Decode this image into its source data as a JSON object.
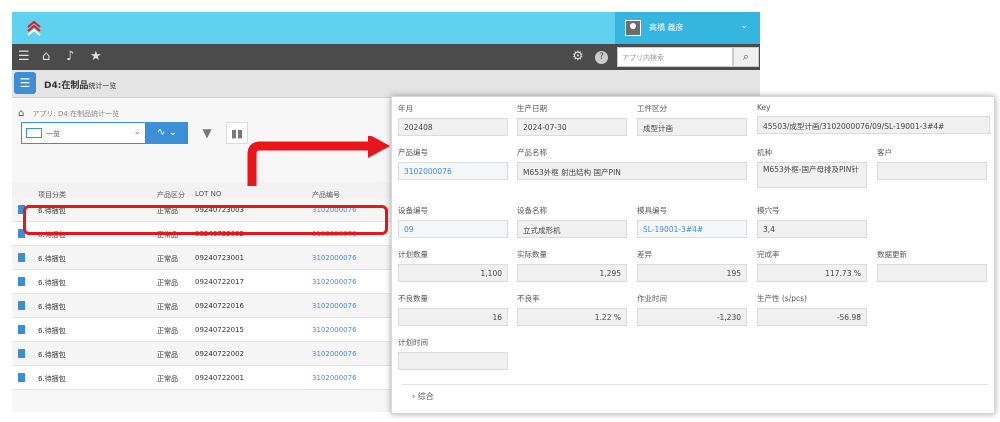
{
  "header": {
    "user_name": "高橋 義彦"
  },
  "toolbar": {
    "search_placeholder": "アプリ内検索"
  },
  "app": {
    "title_main": "D4:在制品",
    "title_sub": "统计一览"
  },
  "breadcrumb": {
    "path": "アプリ: D4:在制品统计一览"
  },
  "view": {
    "selected": "一览"
  },
  "table": {
    "headers": [
      "项目分类",
      "产品区分",
      "LOT NO",
      "产品编号"
    ],
    "rows": [
      [
        "6.待捆包",
        "正常品",
        "09240723003",
        "3102000076"
      ],
      [
        "6.待捆包",
        "正常品",
        "09240723002",
        "3102000076"
      ],
      [
        "6.待捆包",
        "正常品",
        "09240723001",
        "3102000076"
      ],
      [
        "6.待捆包",
        "正常品",
        "09240722017",
        "3102000076"
      ],
      [
        "6.待捆包",
        "正常品",
        "09240722016",
        "3102000076"
      ],
      [
        "6.待捆包",
        "正常品",
        "09240722015",
        "3102000076"
      ],
      [
        "6.待捆包",
        "正常品",
        "09240722002",
        "3102000076"
      ],
      [
        "6.待捆包",
        "正常品",
        "09240722001",
        "3102000076"
      ]
    ]
  },
  "detail": {
    "nianyue": {
      "label": "年月",
      "value": "202408"
    },
    "shengchan_riqi": {
      "label": "生产日期",
      "value": "2024-07-30"
    },
    "gongjian_qufen": {
      "label": "工件区分",
      "value": "成型计画"
    },
    "key": {
      "label": "Key",
      "value": "45503/成型计画/3102000076/09/SL-19001-3#4#"
    },
    "chanpin_bianhao": {
      "label": "产品编号",
      "value": "3102000076"
    },
    "chanpin_mingcheng": {
      "label": "产品名称",
      "value": "M653外框 射出结构 国产PIN"
    },
    "jizhong": {
      "label": "机种",
      "value": "M653外框-国产母排及PIN针"
    },
    "kehu": {
      "label": "客户",
      "value": ""
    },
    "shebei_bianhao": {
      "label": "设备编号",
      "value": "09"
    },
    "shebei_mingcheng": {
      "label": "设备名称",
      "value": "立式成形机"
    },
    "mouju_bianhao": {
      "label": "模具编号",
      "value": "SL-19001-3#4#"
    },
    "moxuehao": {
      "label": "模穴号",
      "value": "3,4"
    },
    "jihua_shuliang": {
      "label": "计划数量",
      "value": "1,100"
    },
    "shiji_shuliang": {
      "label": "实际数量",
      "value": "1,295"
    },
    "chayi": {
      "label": "差异",
      "value": "195"
    },
    "wanchenglv": {
      "label": "完成率",
      "value": "117.73 %"
    },
    "shuju_gengxin": {
      "label": "数据更新",
      "value": ""
    },
    "buliang_shu": {
      "label": "不良数量",
      "value": "16"
    },
    "buliang_lv": {
      "label": "不良率",
      "value": "1.22 %"
    },
    "zuoye_shijian": {
      "label": "作业时间",
      "value": "-1,230"
    },
    "shengchanxing": {
      "label": "生产性 (s/pcs)",
      "value": "-56.98"
    },
    "jihua_shijian": {
      "label": "计划时间",
      "value": ""
    },
    "group_label": "综合"
  },
  "colors": {
    "header": "#5ed2ee",
    "accent": "#3a8fd6",
    "highlight": "#e8161b"
  }
}
